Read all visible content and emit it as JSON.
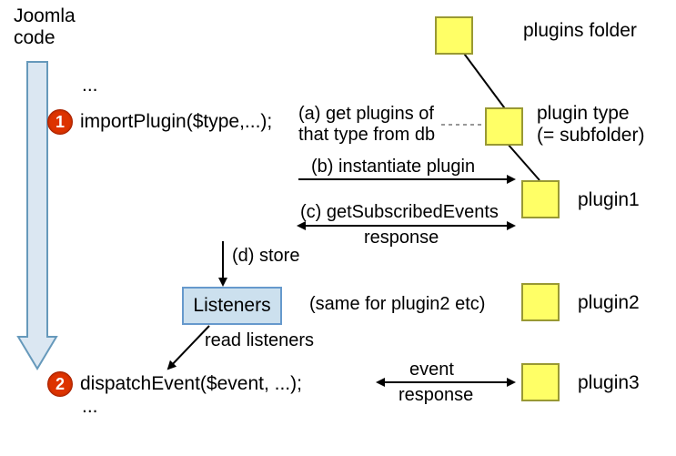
{
  "title": "Joomla\ncode",
  "ellipsis_top": "...",
  "ellipsis_bottom": "...",
  "step1_num": "1",
  "step1_code": "importPlugin($type,...);",
  "step2_num": "2",
  "step2_code": "dispatchEvent($event, ...);",
  "a_label": "(a) get plugins of\nthat type from db",
  "b_label": "(b) instantiate plugin",
  "c_label": "(c) getSubscribedEvents",
  "c_response": "response",
  "d_label": "(d) store",
  "listeners_box": "Listeners",
  "read_listeners": "read listeners",
  "same_for": "(same for plugin2 etc)",
  "event_label": "event",
  "event_response": "response",
  "folder_labels": {
    "plugins_folder": "plugins folder",
    "plugin_type": "plugin type\n(= subfolder)",
    "plugin1": "plugin1",
    "plugin2": "plugin2",
    "plugin3": "plugin3"
  }
}
